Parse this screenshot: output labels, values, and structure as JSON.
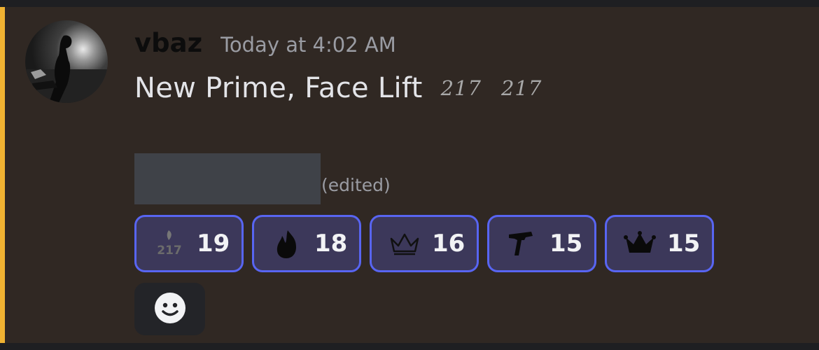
{
  "message": {
    "author": "vbaz",
    "timestamp": "Today at 4:02 AM",
    "text": "New Prime, Face Lift",
    "inline_emojis": [
      "217",
      "217"
    ],
    "edited_label": "(edited)",
    "highlight_color": "#f0b232"
  },
  "reactions": [
    {
      "icon": "emoji-217-icon",
      "count": "19"
    },
    {
      "icon": "emoji-fire-icon",
      "count": "18"
    },
    {
      "icon": "emoji-crown-outline-icon",
      "count": "16"
    },
    {
      "icon": "emoji-uzi-icon",
      "count": "15"
    },
    {
      "icon": "emoji-crown-black-icon",
      "count": "15"
    }
  ],
  "add_reaction": {
    "icon": "smiley-add-reaction-icon"
  }
}
